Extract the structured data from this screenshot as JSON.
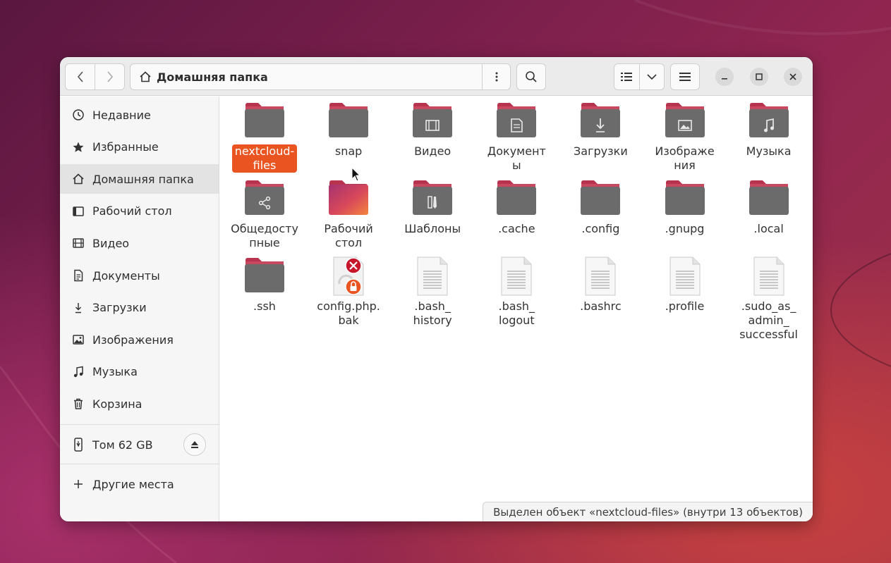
{
  "colors": {
    "accent": "#e95420",
    "folder_body": "#6b6b6b",
    "folder_tab": "#b8344e"
  },
  "header": {
    "path_icon": "home-icon",
    "path_label": "Домашняя папка"
  },
  "sidebar": {
    "items": [
      {
        "label": "Недавние",
        "icon": "clock-icon"
      },
      {
        "label": "Избранные",
        "icon": "star-icon"
      },
      {
        "label": "Домашняя папка",
        "icon": "home-icon",
        "active": true
      },
      {
        "label": "Рабочий стол",
        "icon": "desktop-icon"
      },
      {
        "label": "Видео",
        "icon": "film-icon"
      },
      {
        "label": "Документы",
        "icon": "document-icon"
      },
      {
        "label": "Загрузки",
        "icon": "download-icon"
      },
      {
        "label": "Изображения",
        "icon": "image-icon"
      },
      {
        "label": "Музыка",
        "icon": "music-icon"
      },
      {
        "label": "Корзина",
        "icon": "trash-icon"
      }
    ],
    "volume": {
      "label": "Том 62 GB",
      "icon": "usb-drive-icon"
    },
    "other": {
      "label": "Другие места",
      "icon": "plus-icon"
    }
  },
  "files": [
    {
      "label": "nextcloud-\nfiles",
      "type": "folder",
      "emblem": "",
      "selected": true
    },
    {
      "label": "snap",
      "type": "folder",
      "emblem": ""
    },
    {
      "label": "Видео",
      "type": "folder",
      "emblem": "film"
    },
    {
      "label": "Документ\nы",
      "type": "folder",
      "emblem": "document"
    },
    {
      "label": "Загрузки",
      "type": "folder",
      "emblem": "download"
    },
    {
      "label": "Изображе\nния",
      "type": "folder",
      "emblem": "image"
    },
    {
      "label": "Музыка",
      "type": "folder",
      "emblem": "music"
    },
    {
      "label": "Общедосту\nпные",
      "type": "folder",
      "emblem": "share"
    },
    {
      "label": "Рабочий\nстол",
      "type": "desktop-folder",
      "emblem": ""
    },
    {
      "label": "Шаблоны",
      "type": "folder",
      "emblem": "template"
    },
    {
      "label": ".cache",
      "type": "folder",
      "emblem": ""
    },
    {
      "label": ".config",
      "type": "folder",
      "emblem": ""
    },
    {
      "label": ".gnupg",
      "type": "folder",
      "emblem": ""
    },
    {
      "label": ".local",
      "type": "folder",
      "emblem": ""
    },
    {
      "label": ".ssh",
      "type": "folder",
      "emblem": ""
    },
    {
      "label": "config.php.\nbak",
      "type": "locked-file",
      "emblem": ""
    },
    {
      "label": ".bash_\nhistory",
      "type": "text-file",
      "emblem": ""
    },
    {
      "label": ".bash_\nlogout",
      "type": "text-file",
      "emblem": ""
    },
    {
      "label": ".bashrc",
      "type": "text-file",
      "emblem": ""
    },
    {
      "label": ".profile",
      "type": "text-file",
      "emblem": ""
    },
    {
      "label": ".sudo_as_\nadmin_\nsuccessful",
      "type": "text-file",
      "emblem": ""
    }
  ],
  "status": {
    "text": "Выделен объект «nextcloud-files»  (внутри 13 объектов)"
  }
}
